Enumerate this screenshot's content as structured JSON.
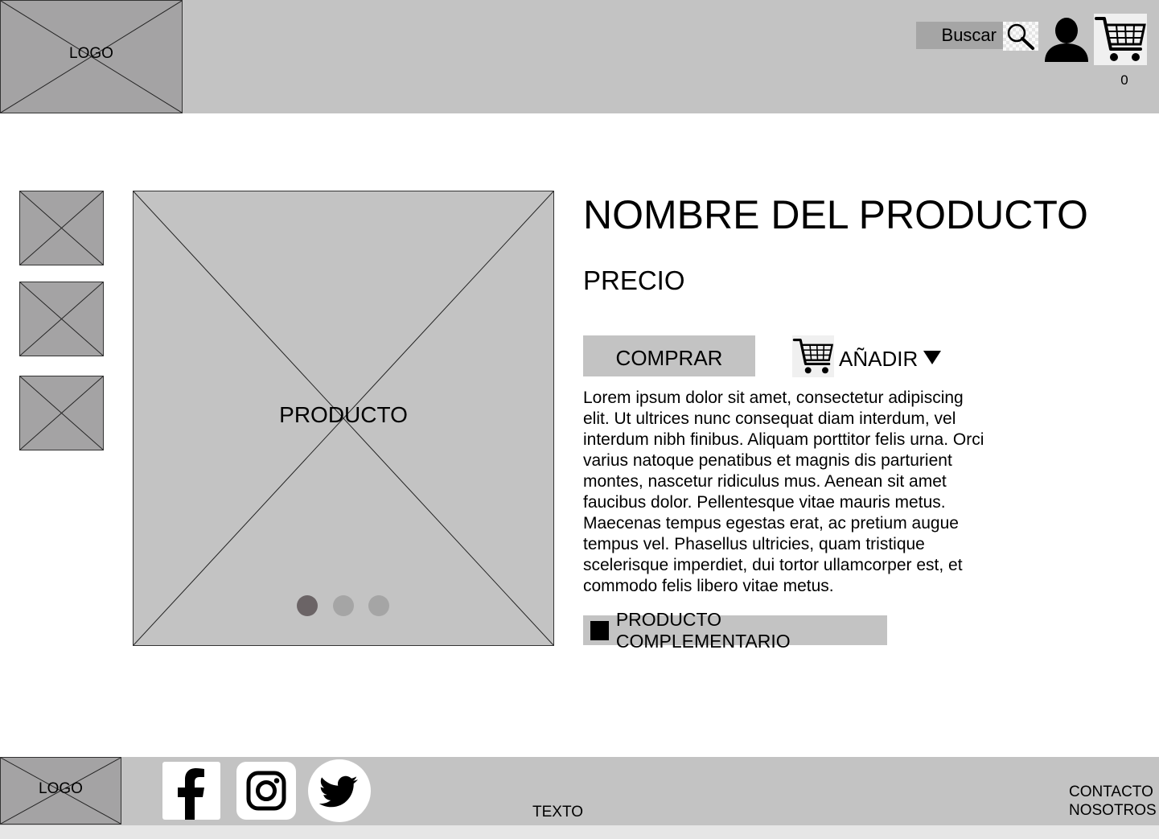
{
  "header": {
    "logo_text": "LOGO",
    "search_label": "Buscar",
    "cart_count": "0"
  },
  "gallery": {
    "thumbnail_count": 3,
    "main_image_text": "PRODUCTO",
    "active_slide": 1,
    "slide_count": 3
  },
  "product": {
    "name": "NOMBRE DEL PRODUCTO",
    "price": "PRECIO",
    "buy_label": "COMPRAR",
    "add_label": "AÑADIR",
    "description": "Lorem ipsum dolor sit amet, consectetur adipiscing elit. Ut ultrices nunc consequat diam interdum, vel interdum nibh finibus. Aliquam porttitor felis urna. Orci varius natoque penatibus et magnis dis parturient montes, nascetur ridiculus mus. Aenean sit amet faucibus dolor. Pellentesque vitae mauris metus. Maecenas tempus egestas erat, ac pretium augue tempus vel. Phasellus ultricies, quam tristique scelerisque imperdiet, dui tortor ullamcorper est, et commodo felis libero vitae metus.",
    "complement_label": "PRODUCTO COMPLEMENTARIO"
  },
  "footer": {
    "logo_text": "LOGO",
    "text": "TEXTO",
    "links": [
      "CONTACTO",
      "NOSOTROS"
    ],
    "social": [
      "facebook-icon",
      "instagram-icon",
      "twitter-icon"
    ]
  },
  "colors": {
    "header_bg": "#c3c3c3",
    "placeholder_dark": "#a4a3a4",
    "dot_active": "#6b6466",
    "dot_inactive": "#a5a5a5"
  }
}
